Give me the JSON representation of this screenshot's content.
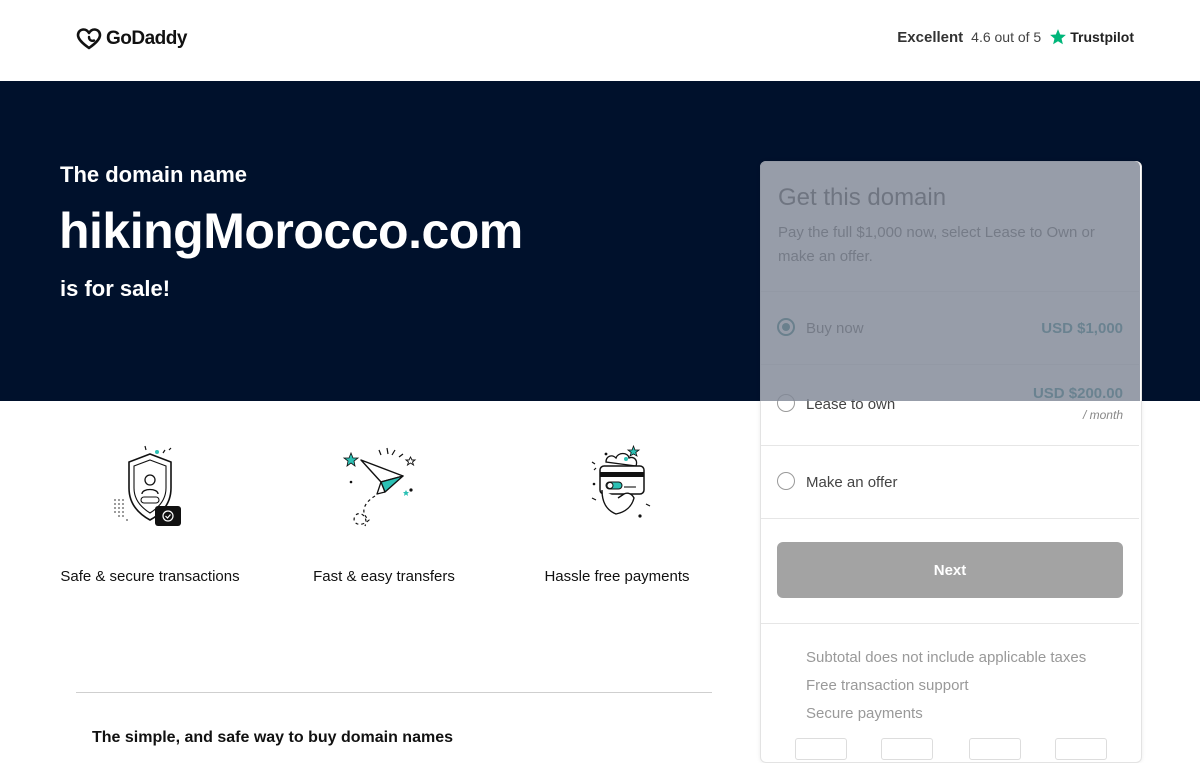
{
  "header": {
    "logo_text": "GoDaddy",
    "trust_excellent": "Excellent",
    "trust_rating": "4.6 out of 5",
    "trust_brand": "Trustpilot"
  },
  "hero": {
    "pre": "The domain name",
    "domain": "hikingMorocco.com",
    "post": "is for sale!"
  },
  "features": [
    {
      "icon": "shield-icon",
      "label": "Safe & secure transactions"
    },
    {
      "icon": "paper-plane-icon",
      "label": "Fast & easy transfers"
    },
    {
      "icon": "payment-card-icon",
      "label": "Hassle free payments"
    }
  ],
  "bottom": {
    "heading": "The simple, and safe way to buy domain names"
  },
  "panel": {
    "title": "Get this domain",
    "description": "Pay the full $1,000 now, select Lease to Own or make an offer.",
    "options": [
      {
        "label": "Buy now",
        "price": "USD $1,000",
        "selected": true
      },
      {
        "label": "Lease to own",
        "price": "USD $200.00",
        "sub": "/ month",
        "selected": false
      },
      {
        "label": "Make an offer",
        "selected": false
      }
    ],
    "next_label": "Next",
    "perks": [
      "Subtotal does not include applicable taxes",
      "Free transaction support",
      "Secure payments"
    ]
  },
  "colors": {
    "hero_bg": "#00112c",
    "accent": "#0a6a73",
    "trustpilot_green": "#00b67a",
    "button_disabled": "#a3a3a3"
  }
}
